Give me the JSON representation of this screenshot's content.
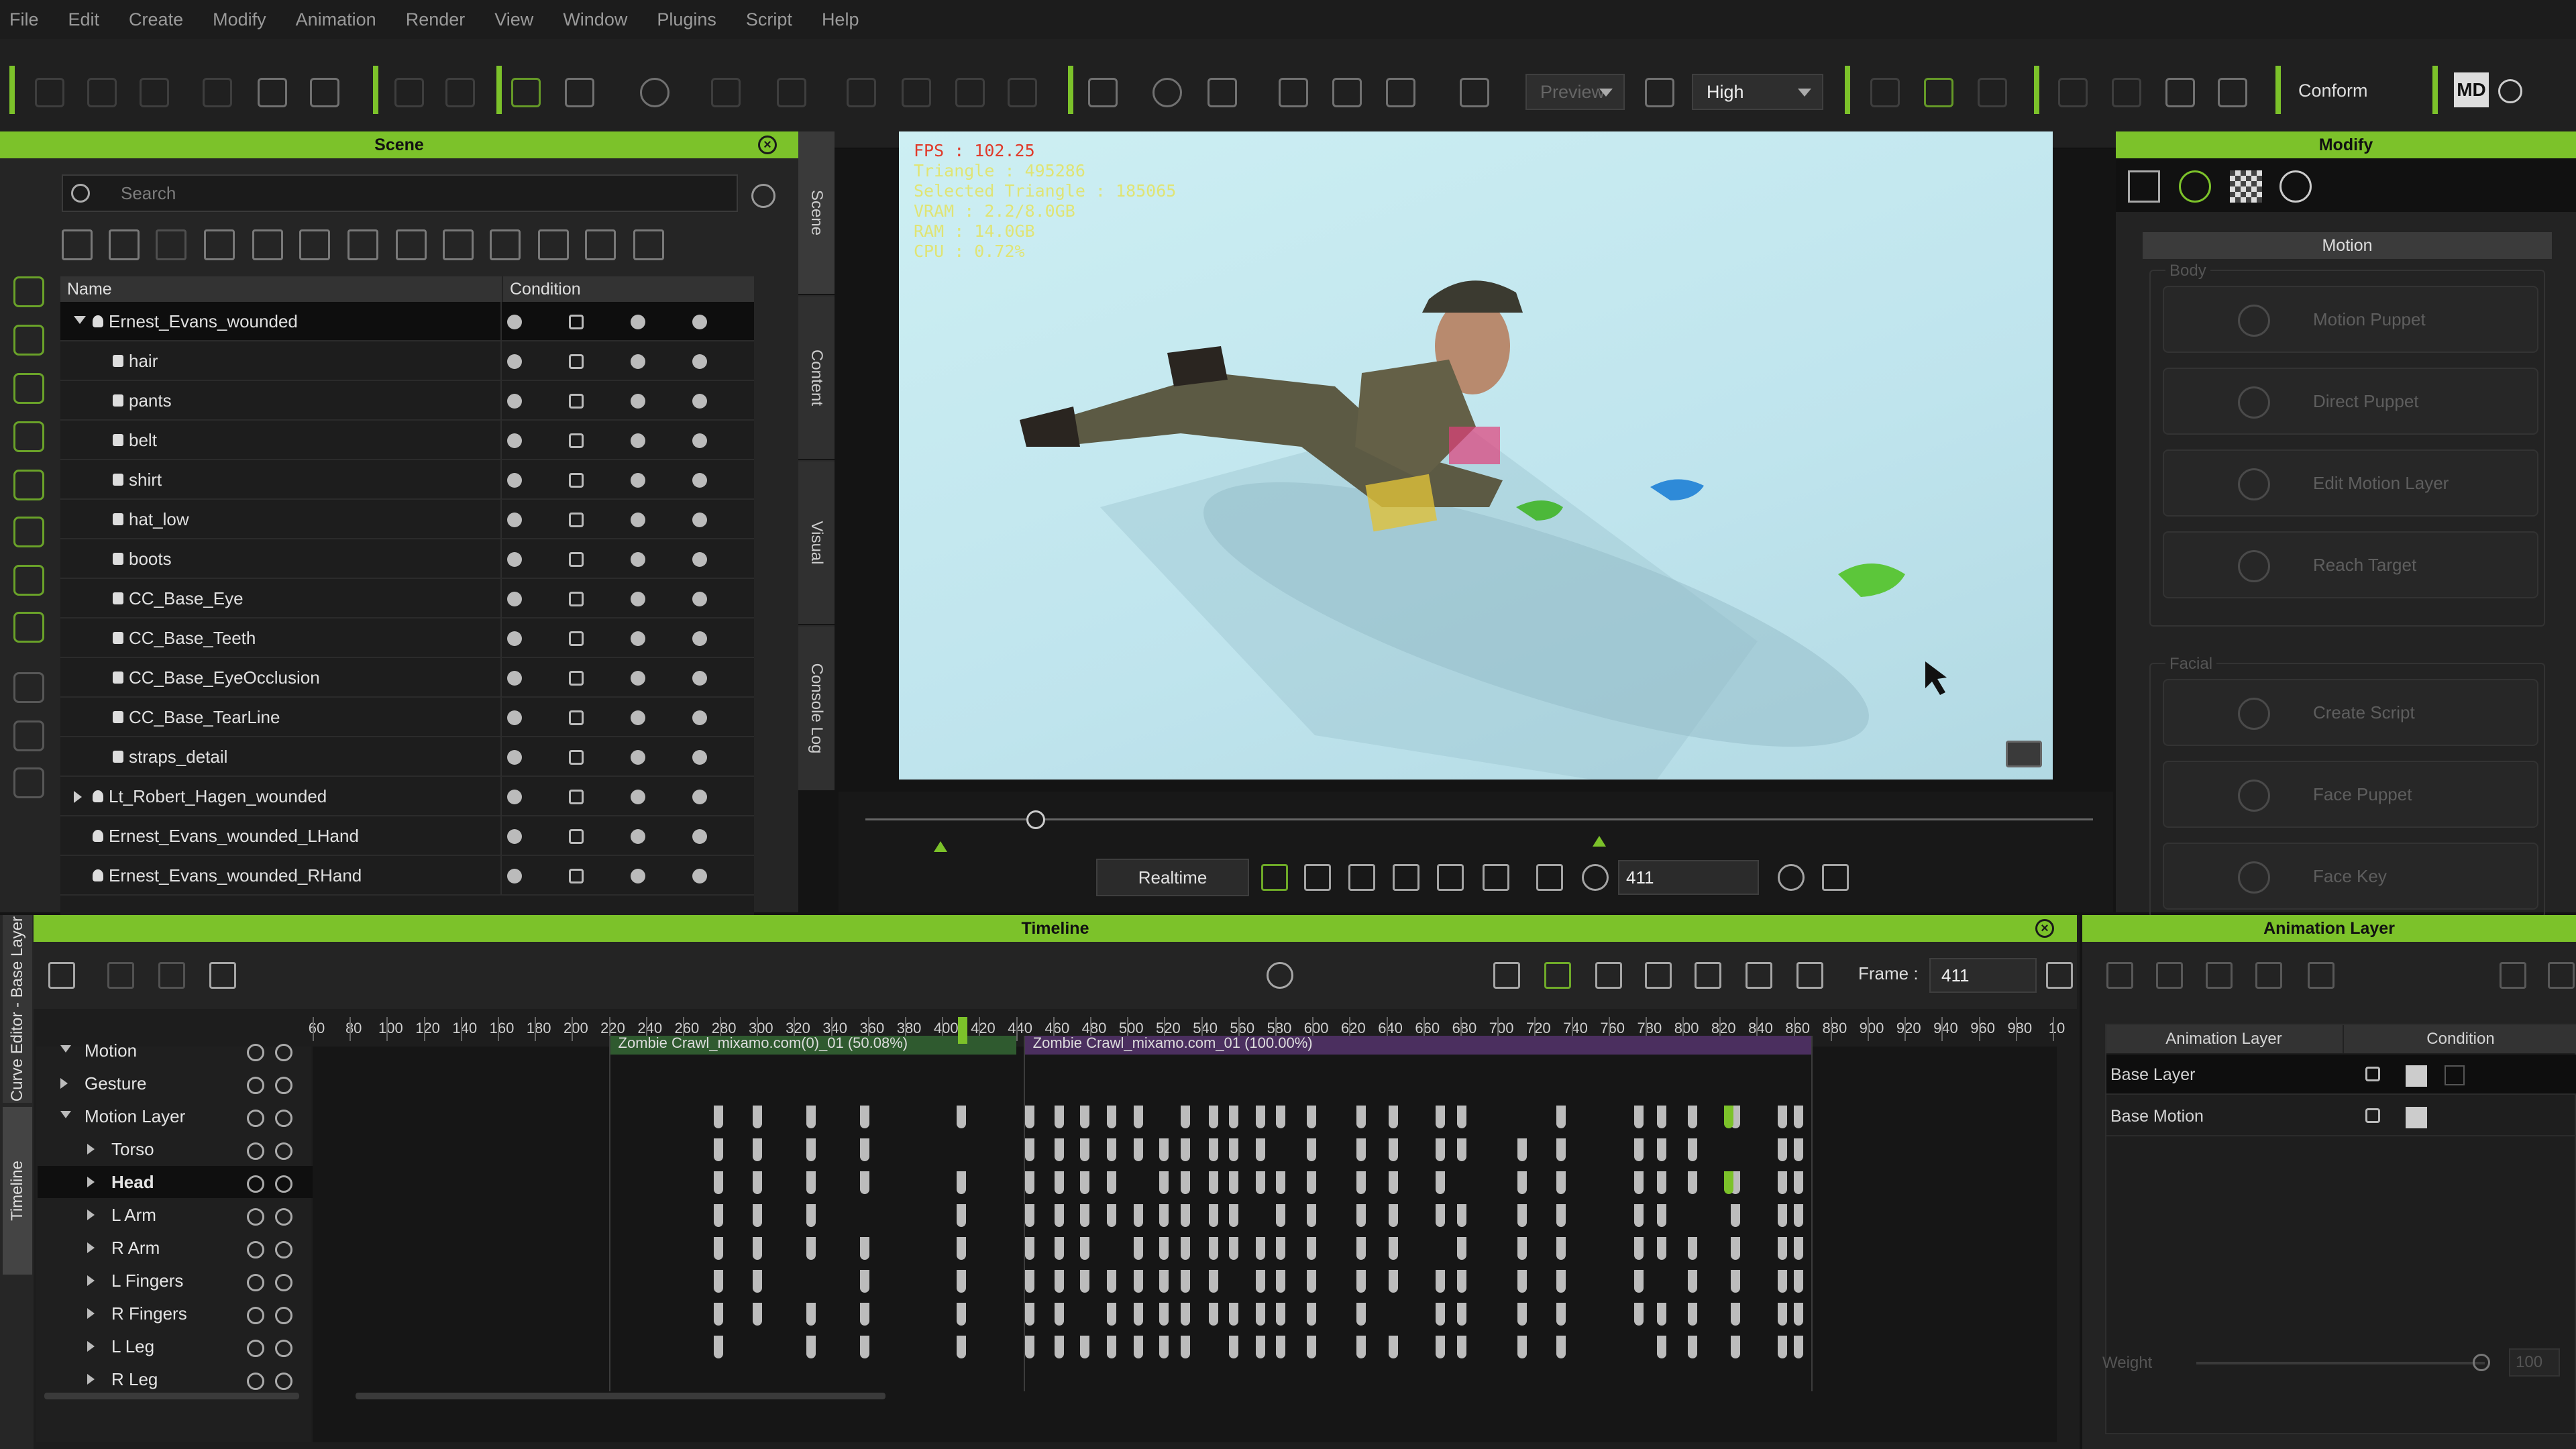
{
  "menu": [
    "File",
    "Edit",
    "Create",
    "Modify",
    "Animation",
    "Render",
    "View",
    "Window",
    "Plugins",
    "Script",
    "Help"
  ],
  "toolbar": {
    "preview_label": "Preview",
    "quality_label": "High",
    "conform_label": "Conform",
    "logo": "MD",
    "icons": [
      "new-icon",
      "open-icon",
      "save-icon",
      "select-icon",
      "move-icon",
      "rotate-icon",
      "scale-icon",
      "light-icon",
      "home-icon",
      "camera-icon"
    ]
  },
  "scene": {
    "title": "Scene",
    "search_placeholder": "Search",
    "col_name": "Name",
    "col_condition": "Condition",
    "items": [
      {
        "label": "Ernest_Evans_wounded",
        "depth": 1,
        "expanded": true,
        "selected": true,
        "icon": "person-icon"
      },
      {
        "label": "hair",
        "depth": 2,
        "icon": "hair-icon"
      },
      {
        "label": "pants",
        "depth": 2,
        "icon": "cloth-icon"
      },
      {
        "label": "belt",
        "depth": 2,
        "icon": "cloth-icon"
      },
      {
        "label": "shirt",
        "depth": 2,
        "icon": "cloth-icon"
      },
      {
        "label": "hat_low",
        "depth": 2,
        "icon": "cloth-icon"
      },
      {
        "label": "boots",
        "depth": 2,
        "icon": "boot-icon"
      },
      {
        "label": "CC_Base_Eye",
        "depth": 2,
        "icon": "eye-icon"
      },
      {
        "label": "CC_Base_Teeth",
        "depth": 2,
        "icon": "teeth-icon"
      },
      {
        "label": "CC_Base_EyeOcclusion",
        "depth": 2,
        "icon": "occlusion-icon"
      },
      {
        "label": "CC_Base_TearLine",
        "depth": 2,
        "icon": "tear-icon"
      },
      {
        "label": "straps_detail",
        "depth": 2,
        "icon": "cloth-icon"
      },
      {
        "label": "Lt_Robert_Hagen_wounded",
        "depth": 1,
        "expanded": false,
        "icon": "person-icon"
      },
      {
        "label": "Ernest_Evans_wounded_LHand",
        "depth": 1,
        "icon": "prop-icon"
      },
      {
        "label": "Ernest_Evans_wounded_RHand",
        "depth": 1,
        "icon": "prop-icon"
      }
    ]
  },
  "side_tabs": [
    "Scene",
    "Content",
    "Visual",
    "Console Log"
  ],
  "viewport": {
    "fps": "FPS : 102.25",
    "stats": [
      "Triangle : 495286",
      "Selected Triangle : 185065",
      "VRAM : 2.2/8.0GB",
      "RAM : 14.0GB",
      "CPU : 0.72%"
    ]
  },
  "playback": {
    "mode": "Realtime",
    "frame": "411"
  },
  "modify": {
    "title": "Modify",
    "section": "Motion",
    "body_label": "Body",
    "facial_label": "Facial",
    "body_buttons": [
      "Motion Puppet",
      "Direct Puppet",
      "Edit Motion Layer",
      "Reach Target"
    ],
    "facial_buttons": [
      "Create Script",
      "Face Puppet",
      "Face Key"
    ]
  },
  "timeline": {
    "title": "Timeline",
    "frame_label": "Frame :",
    "frame_value": "411",
    "left_tabs": [
      "Curve Editor - Base Layer",
      "Timeline"
    ],
    "ruler": [
      "60",
      "80",
      "100",
      "120",
      "140",
      "160",
      "180",
      "200",
      "220",
      "240",
      "260",
      "280",
      "300",
      "320",
      "340",
      "360",
      "380",
      "400",
      "420",
      "440",
      "460",
      "480",
      "500",
      "520",
      "540",
      "560",
      "580",
      "600",
      "620",
      "640",
      "660",
      "680",
      "700",
      "720",
      "740",
      "760",
      "780",
      "800",
      "820",
      "840",
      "860",
      "880",
      "900",
      "920",
      "940",
      "960",
      "980",
      "10"
    ],
    "clips": [
      {
        "label": "Zombie Crawl_mixamo.com(0)_01 (50.08%)"
      },
      {
        "label": "Zombie Crawl_mixamo.com_01 (100.00%)"
      }
    ],
    "tracks": [
      {
        "label": "Motion"
      },
      {
        "label": "Gesture"
      },
      {
        "label": "Motion Layer"
      },
      {
        "label": "Torso"
      },
      {
        "label": "Head",
        "bold": true
      },
      {
        "label": "L Arm"
      },
      {
        "label": "R Arm"
      },
      {
        "label": "L Fingers"
      },
      {
        "label": "R Fingers"
      },
      {
        "label": "L Leg"
      },
      {
        "label": "R Leg"
      }
    ],
    "playhead_frame": 411
  },
  "anim_layer": {
    "title": "Animation Layer",
    "col_layer": "Animation Layer",
    "col_condition": "Condition",
    "rows": [
      {
        "label": "Base Layer"
      },
      {
        "label": "Base Motion"
      }
    ],
    "weight_label": "Weight",
    "weight_value": "100"
  },
  "colors": {
    "accent": "#7cc22a",
    "clip1": "#2f5a2f",
    "clip2": "#4b2f5f"
  }
}
